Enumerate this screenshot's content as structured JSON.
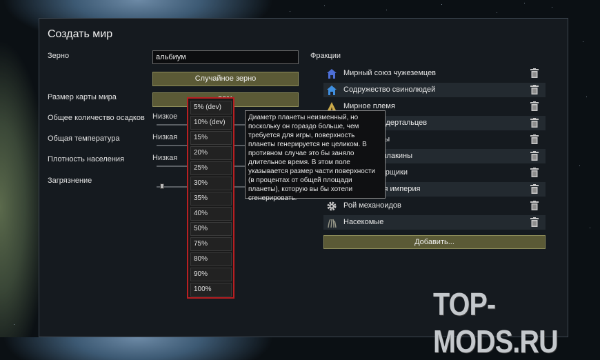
{
  "window": {
    "title": "Создать мир"
  },
  "fields": {
    "seed_label": "Зерно",
    "seed_value": "альбиум",
    "random_seed_button": "Случайное зерно",
    "map_size_label": "Размер карты мира",
    "map_size_value": "30%",
    "rainfall_label": "Общее количество осадков",
    "rainfall_value": "Низкое",
    "temperature_label": "Общая температура",
    "temperature_value": "Низкая",
    "population_label": "Плотность населения",
    "population_value": "Низкая",
    "pollution_label": "Загрязнение"
  },
  "factions": {
    "header": "Фракции",
    "items": [
      {
        "name": "Мирный союз чужеземцев",
        "icon": "house-icon",
        "color": "#4d6fd6"
      },
      {
        "name": "Содружество свинолюдей",
        "icon": "house-icon",
        "color": "#3f8fe0"
      },
      {
        "name": "Мирное племя",
        "icon": "tent-icon",
        "color": "#c9a94a"
      },
      {
        "name": "Племя неандертальцев",
        "icon": "tent-icon",
        "color": "#b07a3a"
      },
      {
        "name": "Пираты-гиды",
        "icon": "skull-icon",
        "color": "#b0b0b0"
      },
      {
        "name": "Пиратские плакины",
        "icon": "skull-icon",
        "color": "#a0a0a0"
      },
      {
        "name": "Пираты-уборщики",
        "icon": "skull-icon",
        "color": "#909090"
      },
      {
        "name": "Изощрённая империя",
        "icon": "crown-icon",
        "color": "#c8b060"
      },
      {
        "name": "Рой механоидов",
        "icon": "gear-icon",
        "color": "#c8c8c8"
      },
      {
        "name": "Насекомые",
        "icon": "insect-icon",
        "color": "#9a9a8a"
      }
    ],
    "add_button": "Добавить..."
  },
  "dropdown": {
    "options": [
      "5% (dev)",
      "10% (dev)",
      "15%",
      "20%",
      "25%",
      "30%",
      "35%",
      "40%",
      "50%",
      "75%",
      "80%",
      "90%",
      "100%"
    ]
  },
  "tooltip": {
    "text": "Диаметр планеты неизменный, но поскольку он гораздо больше, чем требуется для игры, поверхность планеты генерируется не целиком. В противном случае это бы заняло длительное время. В этом поле указывается размер части поверхности (в процентах от общей площади планеты), которую вы бы хотели сгенерировать."
  },
  "watermark": "TOP-MODS.RU",
  "colors": {
    "button_bg": "#5b5a36",
    "dropdown_border": "#b81f22",
    "panel_bg": "#151a1f"
  }
}
